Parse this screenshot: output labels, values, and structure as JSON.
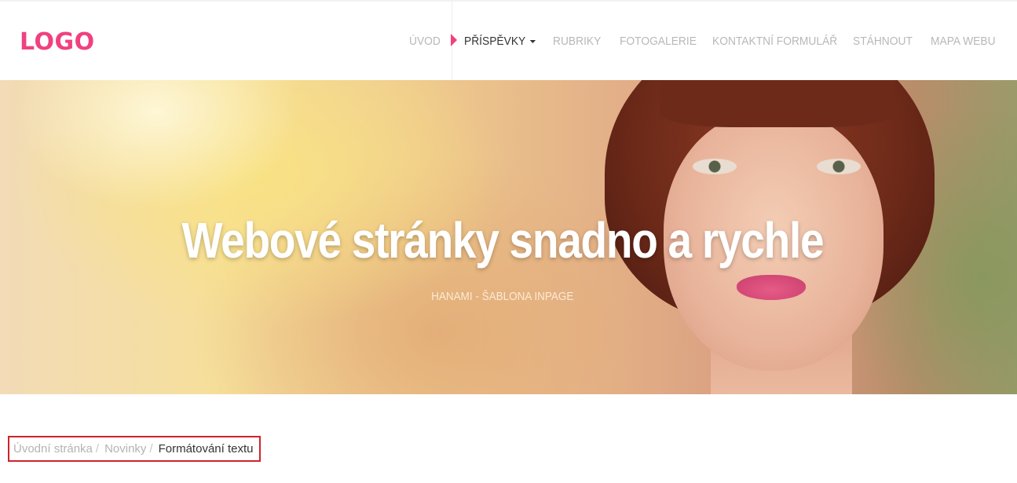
{
  "header": {
    "logo": "LOGO",
    "nav": [
      {
        "label": "Úvod",
        "active": false
      },
      {
        "label": "Příspěvky",
        "active": true,
        "has_dropdown": true
      },
      {
        "label": "Rubriky",
        "active": false
      },
      {
        "label": "Fotogalerie",
        "active": false
      },
      {
        "label": "Kontaktní formulář",
        "active": false
      },
      {
        "label": "Stáhnout",
        "active": false
      },
      {
        "label": "Mapa webu",
        "active": false
      }
    ]
  },
  "hero": {
    "title": "Webové stránky snadno a rychle",
    "subtitle": "Hanami - šablona inPage"
  },
  "breadcrumb": {
    "items": [
      "Úvodní stránka",
      "Novinky"
    ],
    "separator": "/",
    "current": "Formátování textu"
  },
  "colors": {
    "accent": "#f0417f",
    "nav_inactive": "#b8b8b8",
    "nav_active": "#333333",
    "highlight_border": "#d0222b"
  },
  "icons": {
    "active_marker": "triangle-right-icon",
    "dropdown": "caret-down-icon"
  }
}
